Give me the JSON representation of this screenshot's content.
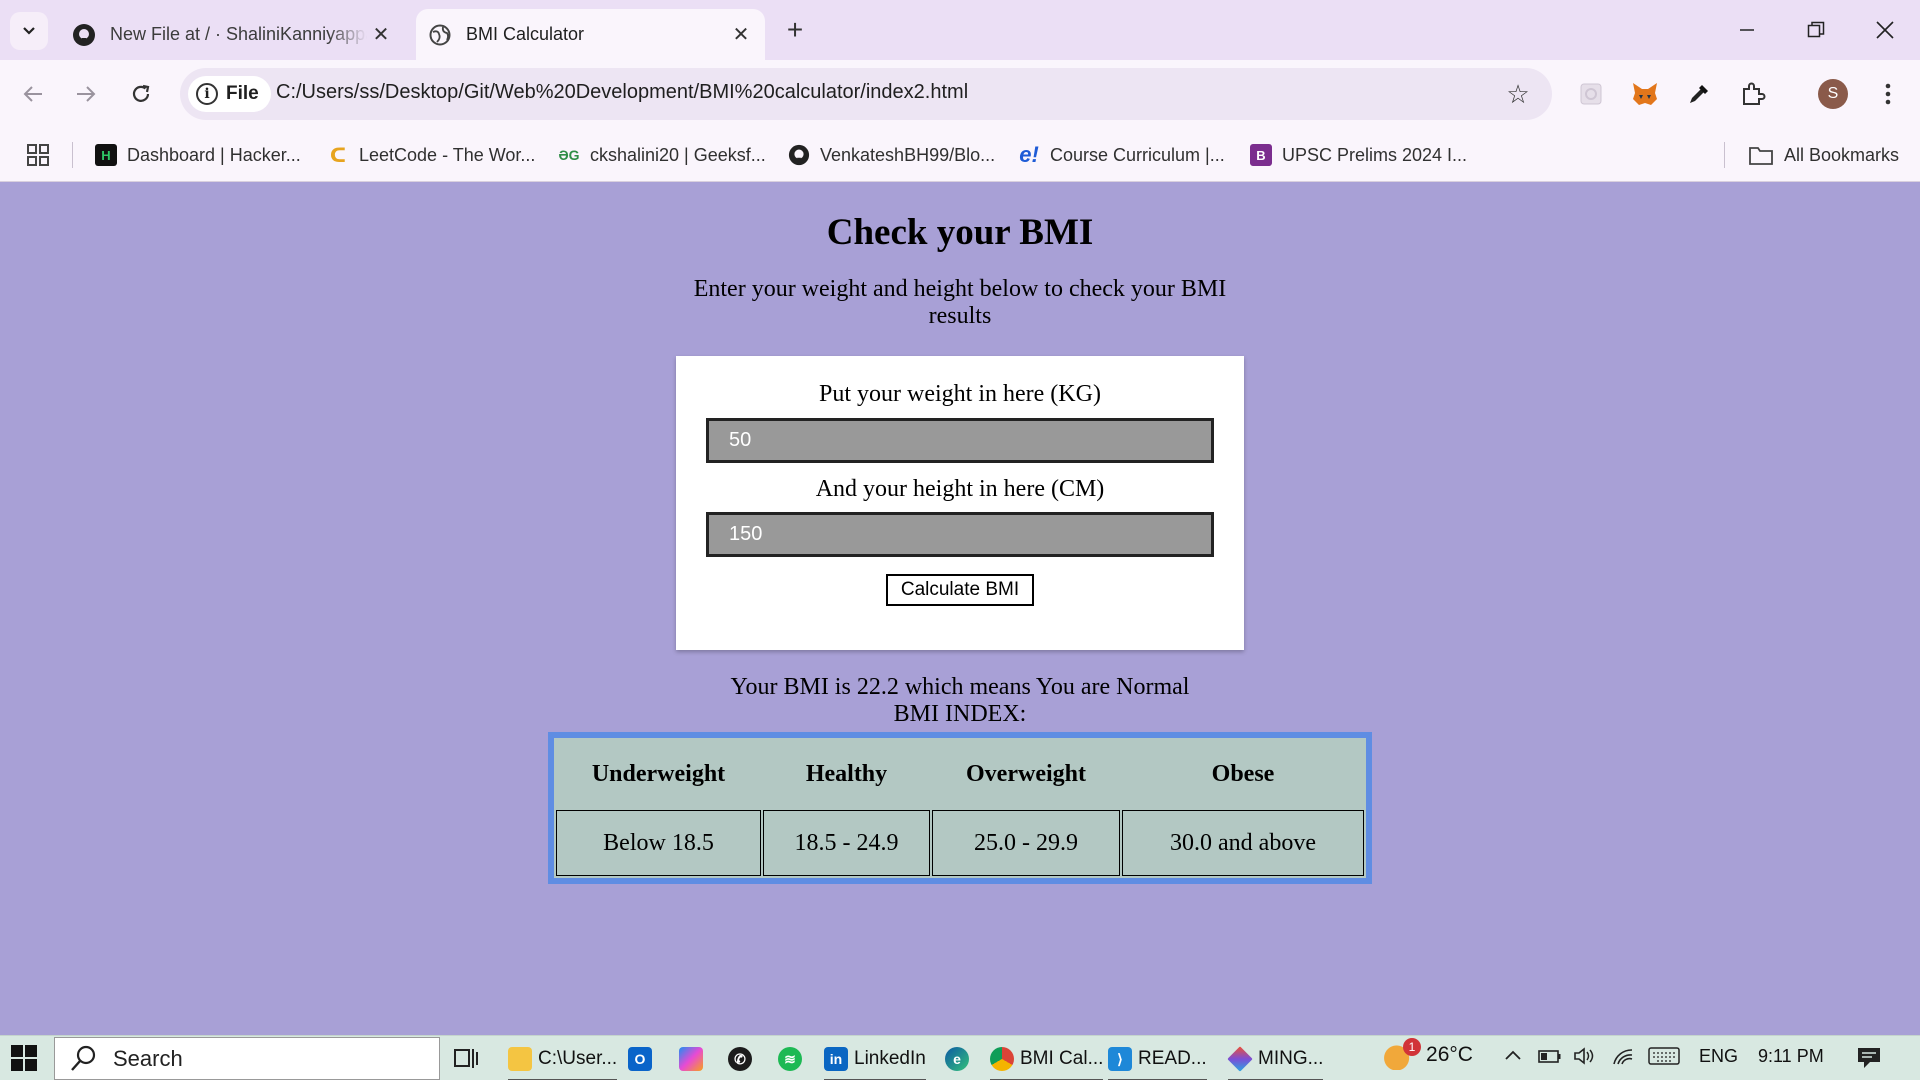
{
  "browser": {
    "tabs": [
      {
        "title": "New File at / · ShaliniKanniyappan",
        "favicon": "github-icon"
      },
      {
        "title": "BMI Calculator",
        "favicon": "globe-icon"
      }
    ],
    "chip_label": "File",
    "url": "C:/Users/ss/Desktop/Git/Web%20Development/BMI%20calculator/index2.html",
    "profile_initial": "S"
  },
  "bookmarks": {
    "items": [
      {
        "label": "Dashboard | Hacker...",
        "icon": "hackerrank-icon"
      },
      {
        "label": "LeetCode - The Wor...",
        "icon": "leetcode-icon"
      },
      {
        "label": "ckshalini20 | Geeksf...",
        "icon": "geeksforgeeks-icon"
      },
      {
        "label": "VenkateshBH99/Blo...",
        "icon": "github-icon"
      },
      {
        "label": "Course Curriculum |...",
        "icon": "course-icon"
      },
      {
        "label": "UPSC Prelims 2024 I...",
        "icon": "upsc-icon"
      }
    ],
    "all_bookmarks": "All Bookmarks"
  },
  "page": {
    "heading": "Check your BMI",
    "intro": "Enter your weight and height below to check your BMI results",
    "weight_label": "Put your weight in here (KG)",
    "weight_value": "50",
    "height_label": "And your height in here (CM)",
    "height_value": "150",
    "button": "Calculate BMI",
    "result_line1": "Your BMI is 22.2 which means You are Normal",
    "result_line2": "BMI INDEX:",
    "table": {
      "headers": [
        "Underweight",
        "Healthy",
        "Overweight",
        "Obese"
      ],
      "values": [
        "Below 18.5",
        "18.5 - 24.9",
        "25.0 - 29.9",
        "30.0 and above"
      ]
    }
  },
  "taskbar": {
    "search": "Search",
    "apps": [
      {
        "label": "C:\\User...",
        "icon": "file-explorer-icon"
      },
      {
        "label": "",
        "icon": "outlook-icon"
      },
      {
        "label": "",
        "icon": "copilot-icon"
      },
      {
        "label": "",
        "icon": "whatsapp-icon"
      },
      {
        "label": "",
        "icon": "spotify-icon"
      },
      {
        "label": "LinkedIn",
        "icon": "linkedin-icon"
      },
      {
        "label": "",
        "icon": "edge-icon"
      },
      {
        "label": "BMI Cal...",
        "icon": "chrome-icon"
      },
      {
        "label": "READ...",
        "icon": "vscode-icon"
      },
      {
        "label": "MING...",
        "icon": "git-icon"
      }
    ],
    "weather_badge": "1",
    "temperature": "26°C",
    "language": "ENG",
    "time": "9:11 PM"
  }
}
